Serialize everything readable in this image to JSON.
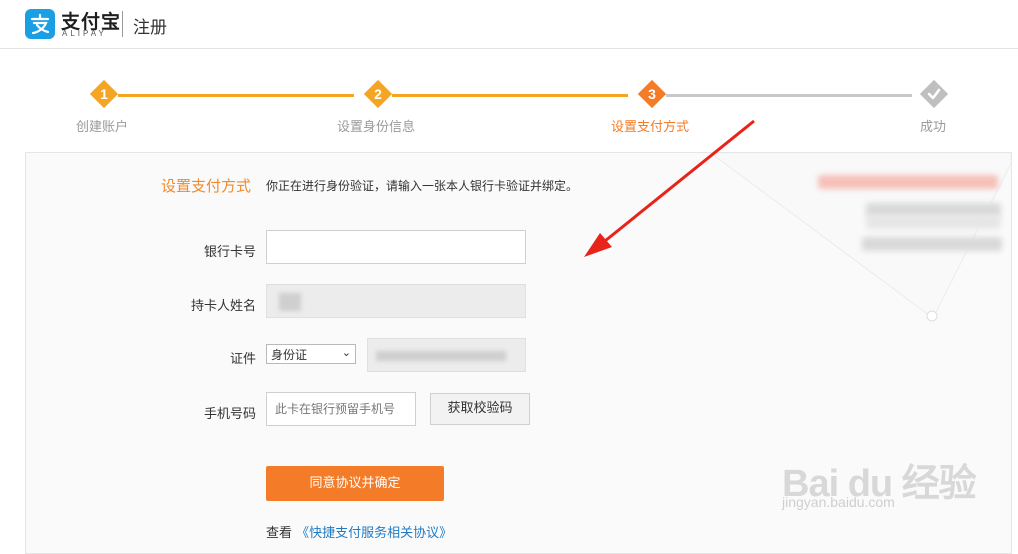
{
  "header": {
    "brand": "支付宝",
    "brand_sub": "ALIPAY",
    "page_name": "注册"
  },
  "steps": [
    {
      "number": "1",
      "label": "创建账户",
      "state": "done"
    },
    {
      "number": "2",
      "label": "设置身份信息",
      "state": "done"
    },
    {
      "number": "3",
      "label": "设置支付方式",
      "state": "active"
    },
    {
      "number": "",
      "label": "成功",
      "state": "pending",
      "icon": "check-icon"
    }
  ],
  "form": {
    "title": "设置支付方式",
    "description": "你正在进行身份验证，请输入一张本人银行卡验证并绑定。",
    "card_number_label": "银行卡号",
    "card_number_value": "",
    "holder_label": "持卡人姓名",
    "id_label": "证件",
    "id_type_selected": "身份证",
    "phone_label": "手机号码",
    "phone_placeholder": "此卡在银行预留手机号",
    "get_code_button": "获取校验码",
    "submit_button": "同意协议并确定",
    "agree_prefix": "查看",
    "agree_link": "《快捷支付服务相关协议》"
  },
  "watermark": {
    "main": "Bai du 经验",
    "sub": "jingyan.baidu.com"
  },
  "colors": {
    "accent": "#f08a2c",
    "active_step": "#f47b27",
    "pending_step": "#bfbfbf",
    "link": "#1f7bc6",
    "brand_blue": "#1a9fe4"
  }
}
